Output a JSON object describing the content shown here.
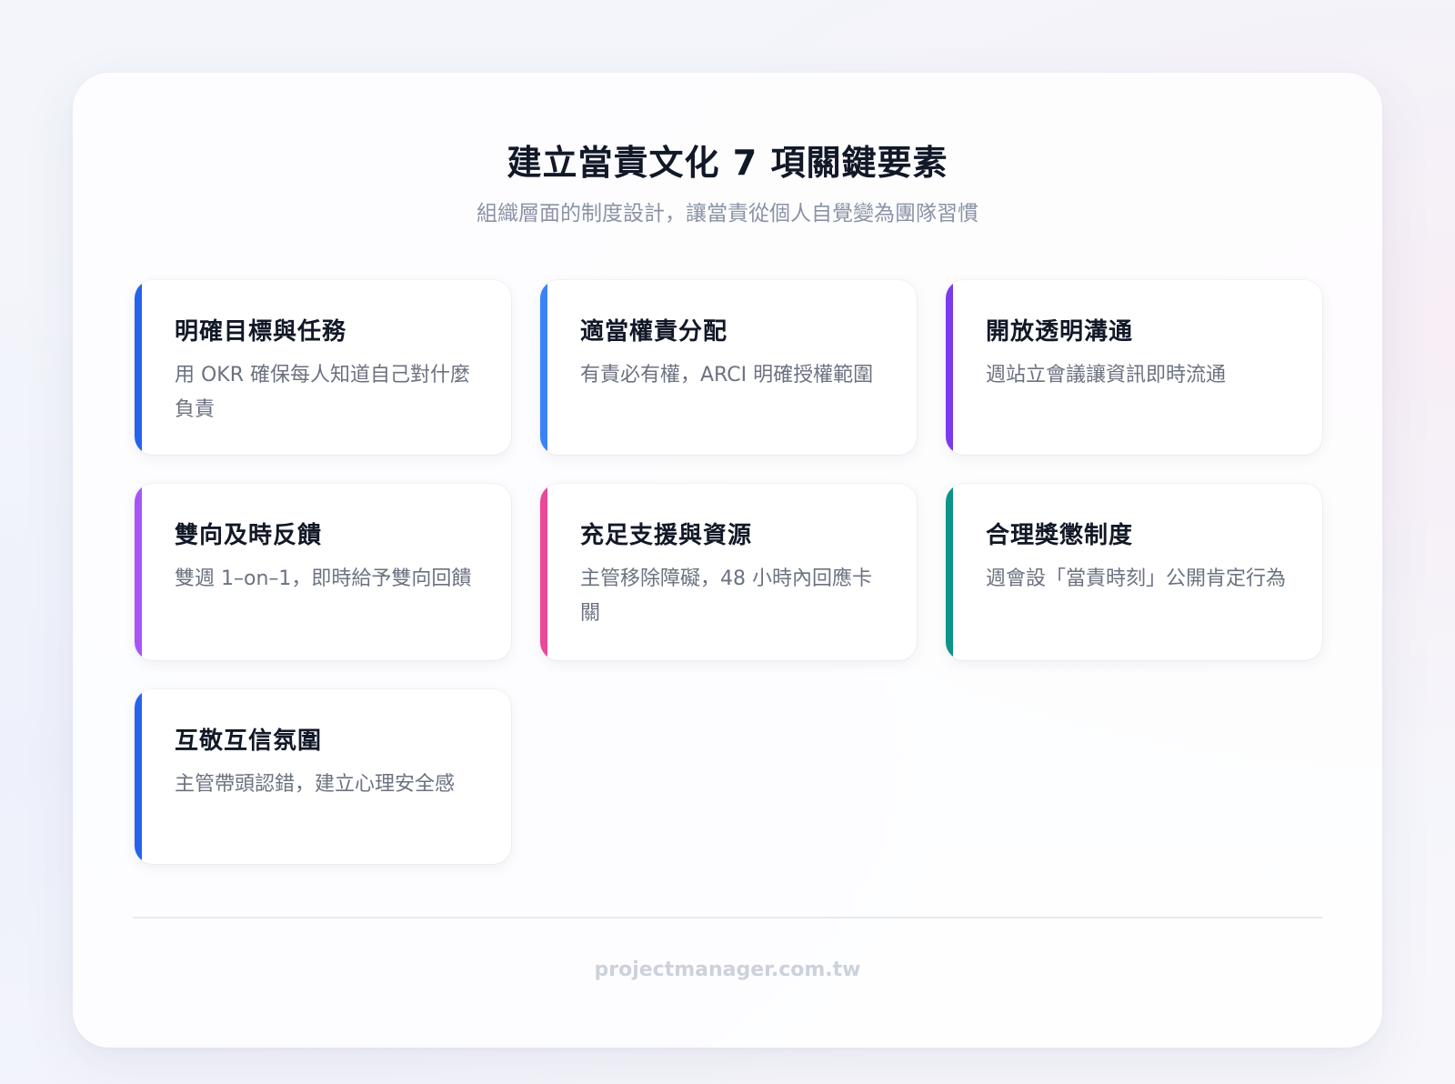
{
  "header": {
    "title": "建立當責文化 7 項關鍵要素",
    "subtitle": "組織層面的制度設計，讓當責從個人自覺變為團隊習慣"
  },
  "items": [
    {
      "title": "明確目標與任務",
      "desc": "用 OKR 確保每人知道自己對什麼負責",
      "color": "#2563eb"
    },
    {
      "title": "適當權責分配",
      "desc": "有責必有權，ARCI 明確授權範圍",
      "color": "#3b82f6"
    },
    {
      "title": "開放透明溝通",
      "desc": "週站立會議讓資訊即時流通",
      "color": "#7c3aed"
    },
    {
      "title": "雙向及時反饋",
      "desc": "雙週 1–on–1，即時給予雙向回饋",
      "color": "#a855f7"
    },
    {
      "title": "充足支援與資源",
      "desc": "主管移除障礙，48 小時內回應卡關",
      "color": "#ec4899"
    },
    {
      "title": "合理獎懲制度",
      "desc": "週會設「當責時刻」公開肯定行為",
      "color": "#0d9488"
    },
    {
      "title": "互敬互信氛圍",
      "desc": "主管帶頭認錯，建立心理安全感",
      "color": "#2563eb"
    }
  ],
  "footer": {
    "text": "projectmanager.com.tw"
  }
}
